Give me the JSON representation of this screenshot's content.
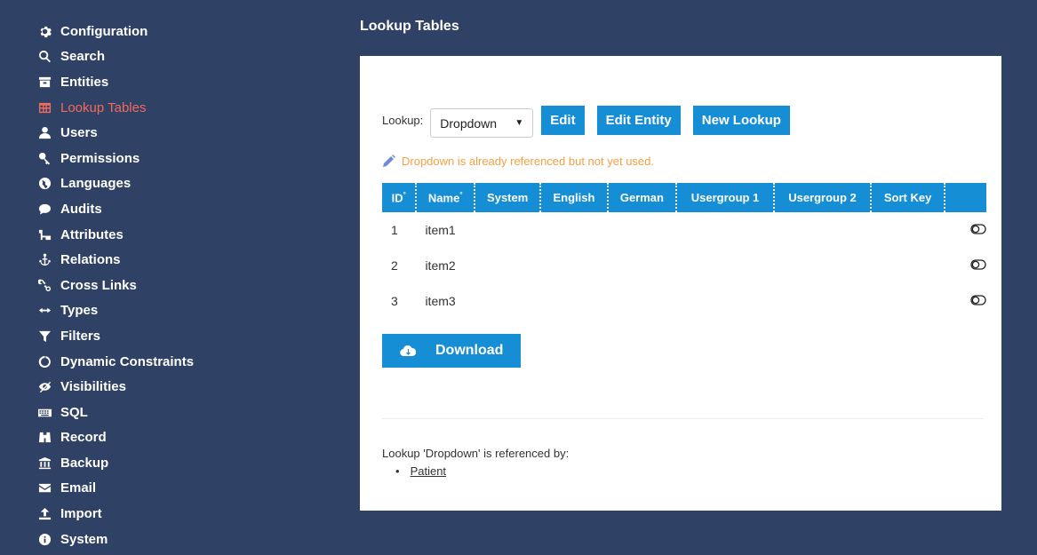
{
  "sidebar": {
    "items": [
      {
        "label": "Configuration",
        "icon": "gear-icon",
        "active": false
      },
      {
        "label": "Search",
        "icon": "search-icon",
        "active": false
      },
      {
        "label": "Entities",
        "icon": "entities-icon",
        "active": false
      },
      {
        "label": "Lookup Tables",
        "icon": "table-icon",
        "active": true
      },
      {
        "label": "Users",
        "icon": "user-icon",
        "active": false
      },
      {
        "label": "Permissions",
        "icon": "key-icon",
        "active": false
      },
      {
        "label": "Languages",
        "icon": "globe-icon",
        "active": false
      },
      {
        "label": "Audits",
        "icon": "comment-icon",
        "active": false
      },
      {
        "label": "Attributes",
        "icon": "sitemap-icon",
        "active": false
      },
      {
        "label": "Relations",
        "icon": "anchor-icon",
        "active": false
      },
      {
        "label": "Cross Links",
        "icon": "link-icon",
        "active": false
      },
      {
        "label": "Types",
        "icon": "arrows-horizontal-icon",
        "active": false
      },
      {
        "label": "Filters",
        "icon": "filter-icon",
        "active": false
      },
      {
        "label": "Dynamic Constraints",
        "icon": "circle-notch-icon",
        "active": false
      },
      {
        "label": "Visibilities",
        "icon": "eye-slash-icon",
        "active": false
      },
      {
        "label": "SQL",
        "icon": "keyboard-icon",
        "active": false
      },
      {
        "label": "Record",
        "icon": "binoculars-icon",
        "active": false
      },
      {
        "label": "Backup",
        "icon": "bank-icon",
        "active": false
      },
      {
        "label": "Email",
        "icon": "envelope-icon",
        "active": false
      },
      {
        "label": "Import",
        "icon": "upload-icon",
        "active": false
      },
      {
        "label": "System",
        "icon": "info-circle-icon",
        "active": false
      }
    ]
  },
  "page": {
    "title": "Lookup Tables"
  },
  "toolbar": {
    "lookup_label": "Lookup:",
    "selected_lookup": "Dropdown",
    "edit_label": "Edit",
    "edit_entity_label": "Edit Entity",
    "new_lookup_label": "New Lookup"
  },
  "warning": {
    "text": "Dropdown is already referenced but not yet used."
  },
  "table": {
    "columns": [
      "ID",
      "Name",
      "System",
      "English",
      "German",
      "Usergroup 1",
      "Usergroup 2",
      "Sort Key"
    ],
    "id_sup": "°",
    "name_sup": "°",
    "rows": [
      {
        "id": "1",
        "name": "item1"
      },
      {
        "id": "2",
        "name": "item2"
      },
      {
        "id": "3",
        "name": "item3"
      }
    ]
  },
  "download_label": "Download",
  "references": {
    "text": "Lookup 'Dropdown' is referenced by:",
    "items": [
      "Patient"
    ]
  },
  "colors": {
    "background": "#2f4164",
    "accent": "#168ed6",
    "active_nav": "#f06a5e",
    "warning": "#f5a042"
  }
}
